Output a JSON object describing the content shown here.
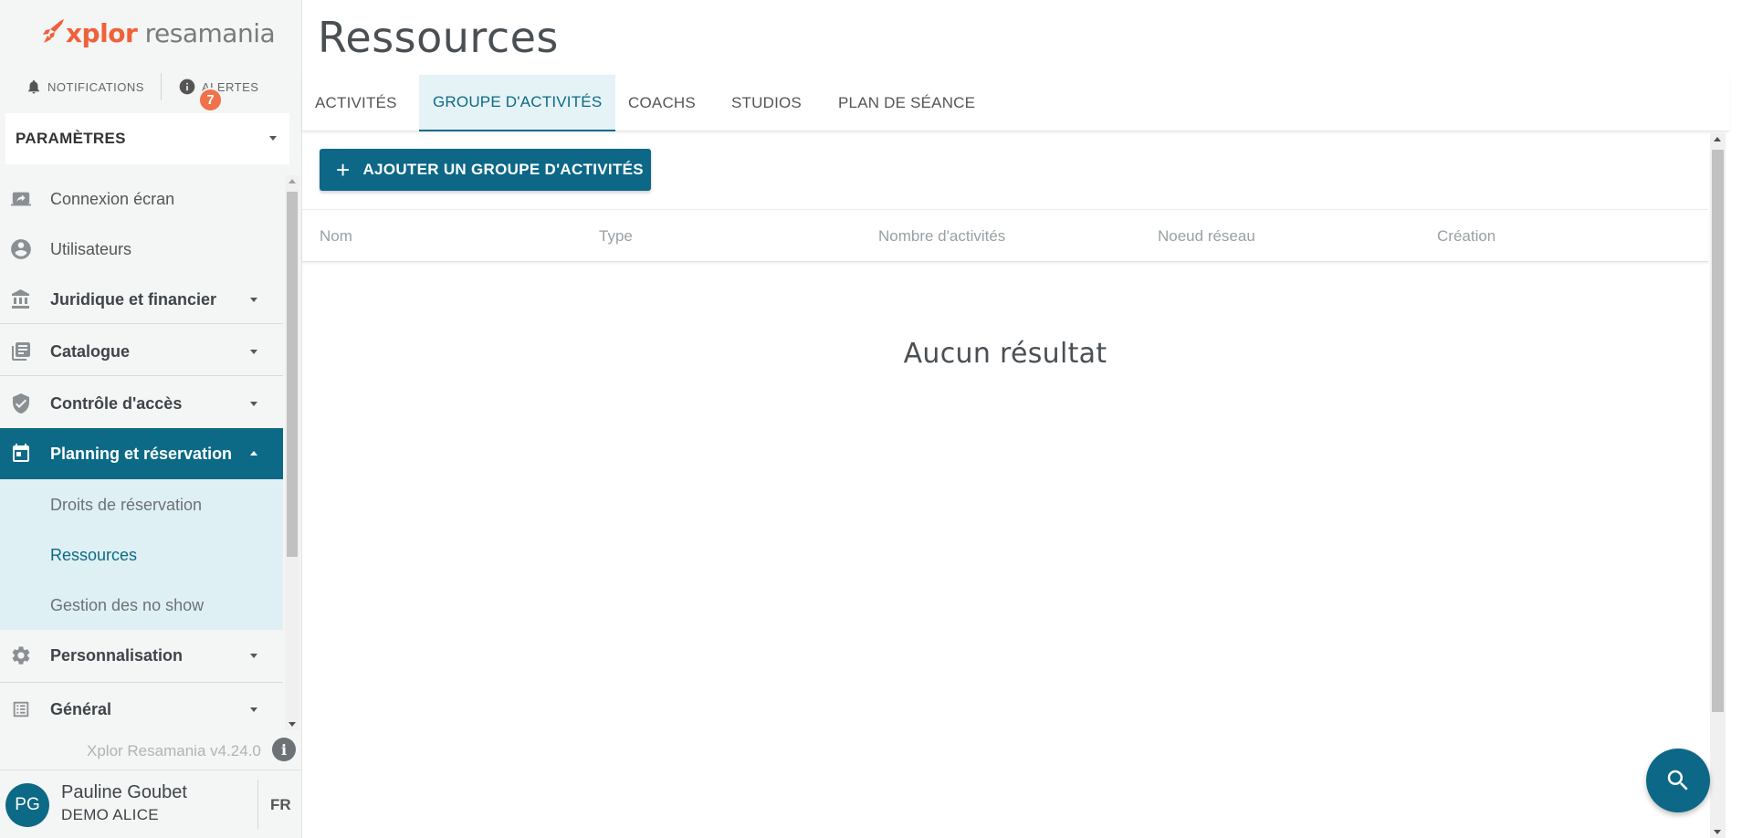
{
  "brand": {
    "logo_x": "xplor",
    "logo_r": " resamania",
    "accent": "#f0613a",
    "primary": "#0c6a86"
  },
  "topbar": {
    "notifications_label": "NOTIFICATIONS",
    "alerts_label": "ALERTES",
    "alerts_count": "7"
  },
  "sidebar": {
    "section_select": "PARAMÈTRES",
    "items": [
      {
        "label": "Connexion écran",
        "icon": "screen-share-icon"
      },
      {
        "label": "Utilisateurs",
        "icon": "user-circle-icon"
      },
      {
        "label": "Juridique et financier",
        "icon": "bank-icon"
      },
      {
        "label": "Catalogue",
        "icon": "library-books-icon"
      },
      {
        "label": "Contrôle d'accès",
        "icon": "shield-check-icon"
      },
      {
        "label": "Planning et réservation",
        "icon": "calendar-icon"
      },
      {
        "label": "Personnalisation",
        "icon": "gear-icon"
      },
      {
        "label": "Général",
        "icon": "list-icon"
      }
    ],
    "subitems": [
      {
        "label": "Droits de réservation"
      },
      {
        "label": "Ressources"
      },
      {
        "label": "Gestion des no show"
      }
    ],
    "version": "Xplor Resamania v4.24.0"
  },
  "user": {
    "initials": "PG",
    "name": "Pauline Goubet",
    "org": "DEMO ALICE",
    "lang": "FR"
  },
  "main": {
    "title": "Ressources",
    "tabs": [
      {
        "label": "ACTIVITÉS"
      },
      {
        "label": "GROUPE D'ACTIVITÉS"
      },
      {
        "label": "COACHS"
      },
      {
        "label": "STUDIOS"
      },
      {
        "label": "PLAN DE SÉANCE"
      }
    ],
    "add_button": "AJOUTER UN GROUPE D'ACTIVITÉS",
    "columns": [
      "Nom",
      "Type",
      "Nombre d'activités",
      "Noeud réseau",
      "Création"
    ],
    "empty_text": "Aucun résultat"
  }
}
